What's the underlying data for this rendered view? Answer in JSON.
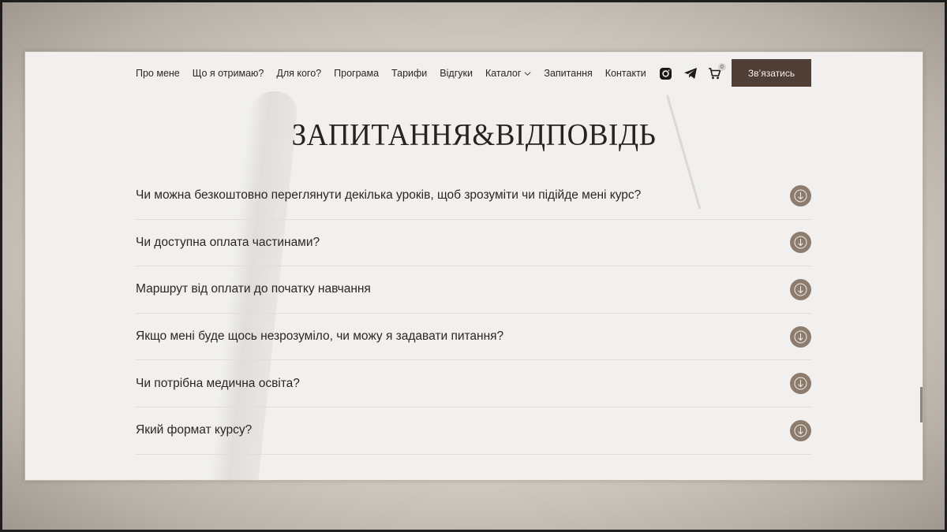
{
  "nav": {
    "items": [
      {
        "label": "Про мене"
      },
      {
        "label": "Що я отримаю?"
      },
      {
        "label": "Для кого?"
      },
      {
        "label": "Програма"
      },
      {
        "label": "Тарифи"
      },
      {
        "label": "Відгуки"
      },
      {
        "label": "Каталог"
      },
      {
        "label": "Запитання"
      },
      {
        "label": "Контакти"
      }
    ],
    "icons": [
      "instagram-icon",
      "telegram-icon",
      "cart-icon"
    ],
    "cart_count": "0",
    "cta_label": "Зв’язатись"
  },
  "title": "ЗАПИТАННЯ&ВІДПОВІДЬ",
  "faq": {
    "items": [
      {
        "question": "Чи можна безкоштовно переглянути декілька уроків, щоб зрозуміти чи підійде мені курс?"
      },
      {
        "question": "Чи доступна оплата частинами?"
      },
      {
        "question": "Маршрут від оплати до початку навчання"
      },
      {
        "question": "Якщо мені буде щось незрозуміло, чи можу я задавати питання?"
      },
      {
        "question": "Чи потрібна медична освіта?"
      },
      {
        "question": "Який формат курсу?"
      }
    ]
  },
  "colors": {
    "accent": "#4f3f36",
    "arrow": "#8d7b6e",
    "page_bg": "#f1f0ee",
    "text": "#2a2623"
  }
}
